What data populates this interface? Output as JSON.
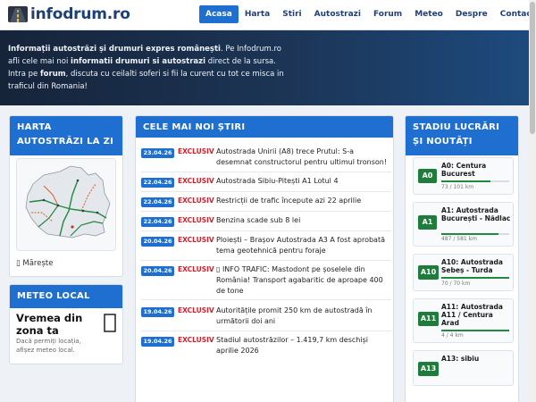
{
  "header": {
    "logo_text": "infodrum.ro",
    "nav": [
      "Acasa",
      "Harta",
      "Stiri",
      "Autostrazi",
      "Forum",
      "Meteo",
      "Despre",
      "Contact"
    ],
    "active_nav": "Acasa"
  },
  "hero": {
    "bold1": "Informații autostrăzi și drumuri expres românești",
    "text1": ". Pe Infodrum.ro afli cele mai noi ",
    "bold2": "informatii drumuri si autostrazi",
    "text2": " direct de la sursa. Intra pe ",
    "bold3": "forum",
    "text3": ", discuta cu ceilalti soferi si fii la curent cu tot ce misca in traficul din Romania!"
  },
  "harta": {
    "title": "HARTA AUTOSTRĂZI LA ZI",
    "zoom_label": "Mărește",
    "zoom_icon": "magnifier-icon"
  },
  "meteo": {
    "title": "METEO LOCAL",
    "heading": "Vremea din zona ta",
    "subtitle": "Dacă permiți locația, afișez meteo local.",
    "icon": "sun-icon"
  },
  "stiri": {
    "title": "CELE MAI NOI ȘTIRI",
    "items": [
      {
        "date": "23.04.26",
        "tag": "EXCLUSIV",
        "title": "Autostrada Unirii (A8) trece Prutul: S-a desemnat constructorul pentru ultimul tronson!"
      },
      {
        "date": "22.04.26",
        "tag": "EXCLUSIV",
        "title": "Autostrada Sibiu-Pitești A1 Lotul 4"
      },
      {
        "date": "22.04.26",
        "tag": "EXCLUSIV",
        "title": "Restricții de trafic începute azi 22 aprilie"
      },
      {
        "date": "22.04.26",
        "tag": "EXCLUSIV",
        "title": "Benzina scade sub 8 lei"
      },
      {
        "date": "20.04.26",
        "tag": "EXCLUSIV",
        "title": "Ploiești – Brașov Autostrada A3 A fost aprobată tema geotehnică pentru foraje"
      },
      {
        "date": "20.04.26",
        "tag": "EXCLUSIV",
        "title": "▯ INFO TRAFIC: Mastodont pe șoselele din România! Transport agabaritic de aproape 400 de tone"
      },
      {
        "date": "19.04.26",
        "tag": "EXCLUSIV",
        "title": "Autoritățile promit 250 km de autostradă în următorii doi ani"
      },
      {
        "date": "19.04.26",
        "tag": "EXCLUSIV",
        "title": "Stadiul autostrăzilor – 1.419,7 km deschiși aprilie 2026"
      }
    ]
  },
  "stadiu": {
    "title": "STADIU LUCRĂRI ȘI NOUTĂȚI",
    "projects": [
      {
        "code": "A0",
        "name": "A0: Centura Bucurest",
        "km": "73 / 101 km",
        "progress": 0.72
      },
      {
        "code": "A1",
        "name": "A1: Autostrada București - Nădlac",
        "km": "487 / 581 km",
        "progress": 0.84
      },
      {
        "code": "A10",
        "name": "A10: Autostrada Sebeș - Turda",
        "km": "70 / 70 km",
        "progress": 1.0
      },
      {
        "code": "A11",
        "name": "A11: Autostrada A11 / Centura Arad",
        "km": "4 / 4 km",
        "progress": 1.0
      },
      {
        "code": "A13",
        "name": "A13: sibiu",
        "km": "",
        "progress": 0
      }
    ]
  },
  "colors": {
    "accent": "#1e6fcf",
    "badge_green": "#1f7d3c",
    "exclusiv_red": "#d11f2c",
    "hero_dark": "#16243a"
  }
}
